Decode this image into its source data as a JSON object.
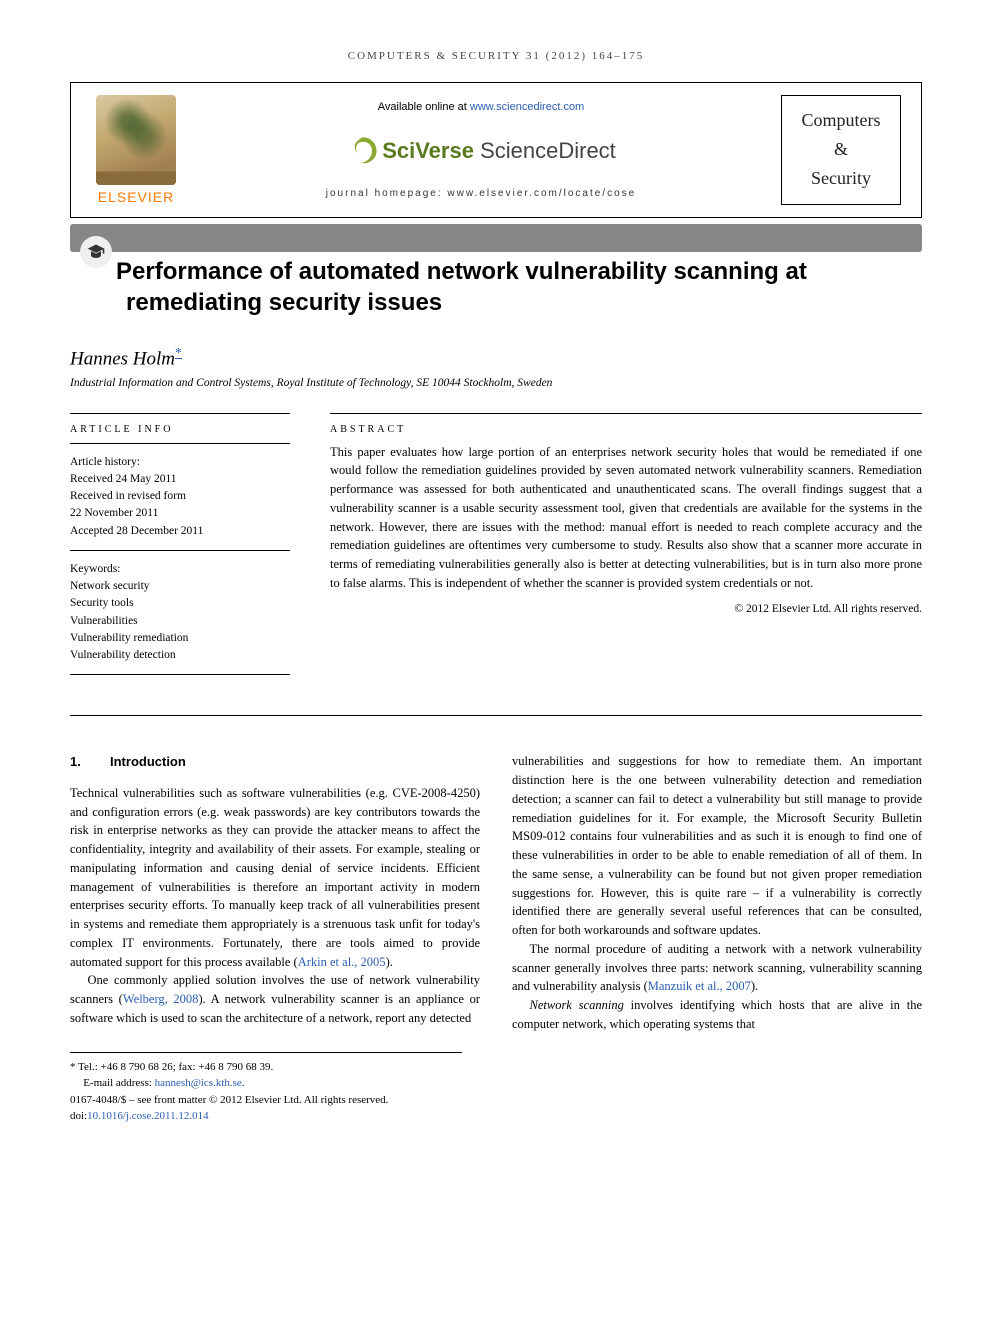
{
  "running_head": "COMPUTERS & SECURITY 31 (2012) 164–175",
  "header": {
    "publisher": "ELSEVIER",
    "available_prefix": "Available online at ",
    "available_link": "www.sciencedirect.com",
    "sd_brand_a": "SciVerse ",
    "sd_brand_b": "ScienceDirect",
    "homepage_label": "journal homepage: www.elsevier.com/locate/cose",
    "journal_line1": "Computers",
    "journal_line2": "&",
    "journal_line3": "Security"
  },
  "title": "Performance of automated network vulnerability scanning at remediating security issues",
  "author": "Hannes Holm",
  "corr_mark": "*",
  "affiliation": "Industrial Information and Control Systems, Royal Institute of Technology, SE 10044 Stockholm, Sweden",
  "info": {
    "heading": "ARTICLE INFO",
    "history_label": "Article history:",
    "received": "Received 24 May 2011",
    "revised_a": "Received in revised form",
    "revised_b": "22 November 2011",
    "accepted": "Accepted 28 December 2011",
    "keywords_label": "Keywords:",
    "kw1": "Network security",
    "kw2": "Security tools",
    "kw3": "Vulnerabilities",
    "kw4": "Vulnerability remediation",
    "kw5": "Vulnerability detection"
  },
  "abstract": {
    "heading": "ABSTRACT",
    "text": "This paper evaluates how large portion of an enterprises network security holes that would be remediated if one would follow the remediation guidelines provided by seven automated network vulnerability scanners. Remediation performance was assessed for both authenticated and unauthenticated scans. The overall findings suggest that a vulnerability scanner is a usable security assessment tool, given that credentials are available for the systems in the network. However, there are issues with the method: manual effort is needed to reach complete accuracy and the remediation guidelines are oftentimes very cumbersome to study. Results also show that a scanner more accurate in terms of remediating vulnerabilities generally also is better at detecting vulnerabilities, but is in turn also more prone to false alarms. This is independent of whether the scanner is provided system credentials or not.",
    "copyright": "© 2012 Elsevier Ltd. All rights reserved."
  },
  "section1": {
    "num": "1.",
    "title": "Introduction",
    "p1a": "Technical vulnerabilities such as software vulnerabilities (e.g. CVE-2008-4250) and configuration errors (e.g. weak passwords) are key contributors towards the risk in enterprise networks as they can provide the attacker means to affect the confidentiality, integrity and availability of their assets. For example, stealing or manipulating information and causing denial of service incidents. Efficient management of vulnerabilities is therefore an important activity in modern enterprises security efforts. To manually keep track of all vulnerabilities present in systems and remediate them appropriately is a strenuous task unfit for today's complex IT environments. Fortunately, there are tools aimed to provide automated support for this process available (",
    "p1ref": "Arkin et al., 2005",
    "p1b": ").",
    "p2a": "One commonly applied solution involves the use of network vulnerability scanners (",
    "p2ref": "Welberg, 2008",
    "p2b": "). A network vulnerability scanner is an appliance or software which is used to scan the architecture of a network, report any detected",
    "p3": "vulnerabilities and suggestions for how to remediate them. An important distinction here is the one between vulnerability detection and remediation detection; a scanner can fail to detect a vulnerability but still manage to provide remediation guidelines for it. For example, the Microsoft Security Bulletin MS09-012 contains four vulnerabilities and as such it is enough to find one of these vulnerabilities in order to be able to enable remediation of all of them. In the same sense, a vulnerability can be found but not given proper remediation suggestions for. However, this is quite rare – if a vulnerability is correctly identified there are generally several useful references that can be consulted, often for both workarounds and software updates.",
    "p4a": "The normal procedure of auditing a network with a network vulnerability scanner generally involves three parts: network scanning, vulnerability scanning and vulnerability analysis (",
    "p4ref": "Manzuik et al., 2007",
    "p4b": ").",
    "p5_em": "Network scanning",
    "p5": " involves identifying which hosts that are alive in the computer network, which operating systems that"
  },
  "footnotes": {
    "tel": "* Tel.: +46 8 790 68 26; fax: +46 8 790 68 39.",
    "email_label": "E-mail address: ",
    "email": "hannesh@ics.kth.se",
    "email_suffix": ".",
    "issn": "0167-4048/$ – see front matter © 2012 Elsevier Ltd. All rights reserved.",
    "doi_prefix": "doi:",
    "doi": "10.1016/j.cose.2011.12.014"
  }
}
